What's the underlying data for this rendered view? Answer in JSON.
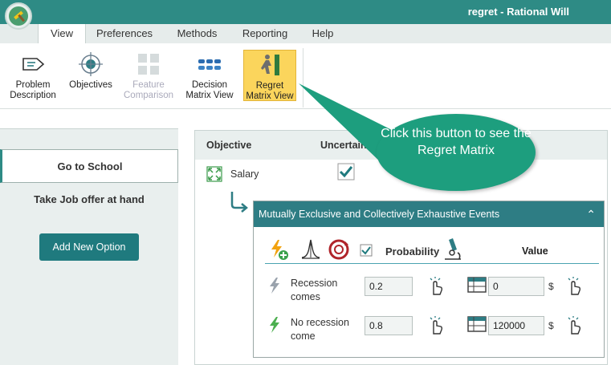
{
  "window": {
    "title": "regret - Rational Will"
  },
  "menu": {
    "tabs": [
      {
        "label": "View"
      },
      {
        "label": "Preferences"
      },
      {
        "label": "Methods"
      },
      {
        "label": "Reporting"
      },
      {
        "label": "Help"
      }
    ]
  },
  "ribbon": {
    "buttons": [
      {
        "label": "Problem Description",
        "icon": "tag-icon"
      },
      {
        "label": "Objectives",
        "icon": "target-icon"
      },
      {
        "label": "Feature Comparison",
        "icon": "grid-icon"
      },
      {
        "label": "Decision Matrix View",
        "icon": "matrix-dots-icon"
      },
      {
        "label": "Regret Matrix View",
        "icon": "regret-figure-icon"
      }
    ]
  },
  "options": {
    "items": [
      {
        "label": "Go to School"
      },
      {
        "label": "Take Job offer at hand"
      }
    ],
    "add_label": "Add New Option"
  },
  "main": {
    "col_objective": "Objective",
    "col_uncertain": "Uncertain",
    "objective_name": "Salary",
    "mece_title": "Mutually Exclusive and Collectively Exhaustive Events",
    "probability_label": "Probability",
    "value_label": "Value",
    "currency": "$",
    "events": [
      {
        "name": "Recession comes",
        "probability": "0.2",
        "value": "0"
      },
      {
        "name": "No recession come",
        "probability": "0.8",
        "value": "120000"
      }
    ]
  },
  "callout": {
    "text": "Click this button to see the Regret Matrix"
  },
  "colors": {
    "accent": "#2e8b85",
    "highlight": "#fbd55c",
    "callout": "#1d9e7e"
  }
}
